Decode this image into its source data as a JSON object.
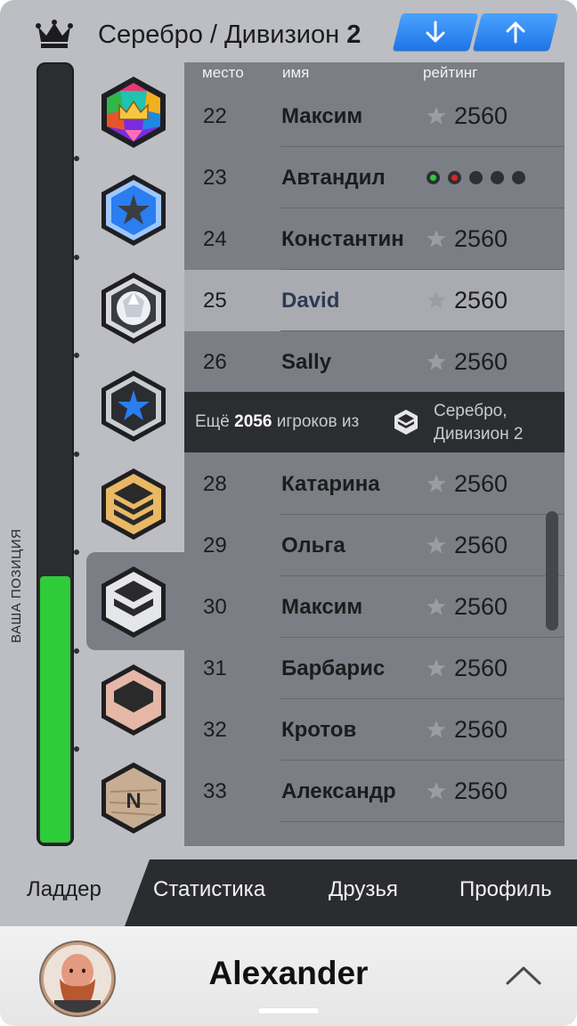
{
  "header": {
    "title_prefix": "Серебро / Дивизион",
    "title_division": "2",
    "crown_icon": "crown-icon",
    "down_button_icon": "arrow-down-icon",
    "up_button_icon": "arrow-up-icon",
    "button_color": "#2f8cf6"
  },
  "sidebar": {
    "position_label": "ВАША ПОЗИЦИЯ",
    "progress_fraction": 0.34,
    "progress_color": "#2fcc3a",
    "badges": [
      {
        "name": "grandmaster-badge-icon"
      },
      {
        "name": "champion-star-badge-icon"
      },
      {
        "name": "diamond-badge-icon"
      },
      {
        "name": "platinum-star-badge-icon"
      },
      {
        "name": "gold-badge-icon"
      },
      {
        "name": "silver-badge-icon",
        "selected": true
      },
      {
        "name": "bronze-badge-icon"
      },
      {
        "name": "wood-badge-icon"
      }
    ]
  },
  "table": {
    "columns": {
      "place": "место",
      "name": "имя",
      "rating": "рейтинг"
    },
    "rows_top": [
      {
        "rank": "22",
        "name": "Максим",
        "rating": "2560"
      },
      {
        "rank": "23",
        "name": "Автандил",
        "rating": "",
        "status_dots": [
          "green",
          "red",
          "dark",
          "dark",
          "dark"
        ]
      },
      {
        "rank": "24",
        "name": "Константин",
        "rating": "2560"
      },
      {
        "rank": "25",
        "name": "David",
        "rating": "2560",
        "current_user": true
      },
      {
        "rank": "26",
        "name": "Sally",
        "rating": "2560"
      }
    ],
    "more": {
      "prefix": "Ещё",
      "count": "2056",
      "suffix": "игроков из",
      "division_line1": "Серебро,",
      "division_line2": "Дивизион 2"
    },
    "rows_bottom": [
      {
        "rank": "28",
        "name": "Катарина",
        "rating": "2560"
      },
      {
        "rank": "29",
        "name": "Ольга",
        "rating": "2560"
      },
      {
        "rank": "30",
        "name": "Максим",
        "rating": "2560"
      },
      {
        "rank": "31",
        "name": "Барбарис",
        "rating": "2560"
      },
      {
        "rank": "32",
        "name": "Кротов",
        "rating": "2560"
      },
      {
        "rank": "33",
        "name": "Александр",
        "rating": "2560"
      }
    ]
  },
  "tabs": [
    {
      "label": "Ладдер",
      "active": true
    },
    {
      "label": "Статистика"
    },
    {
      "label": "Друзья"
    },
    {
      "label": "Профиль"
    }
  ],
  "footer": {
    "user_name": "Alexander",
    "avatar_icon": "user-avatar",
    "expand_icon": "chevron-up-icon"
  }
}
